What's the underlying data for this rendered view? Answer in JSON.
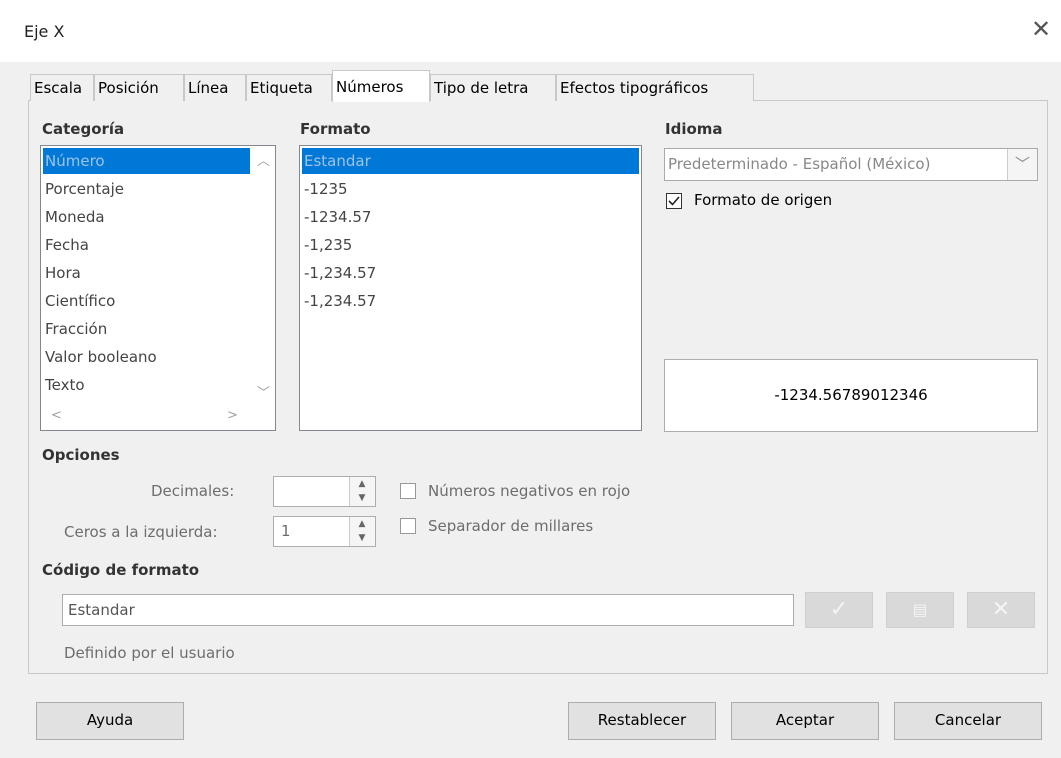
{
  "window": {
    "title": "Eje X",
    "close_glyph": "✕"
  },
  "tabs": [
    {
      "label": "Escala"
    },
    {
      "label": "Posición"
    },
    {
      "label": "Línea"
    },
    {
      "label": "Etiqueta"
    },
    {
      "label": "Números"
    },
    {
      "label": "Tipo de letra"
    },
    {
      "label": "Efectos tipográficos"
    }
  ],
  "categoria": {
    "header": "Categoría",
    "items": [
      "Número",
      "Porcentaje",
      "Moneda",
      "Fecha",
      "Hora",
      "Científico",
      "Fracción",
      "Valor booleano",
      "Texto"
    ],
    "selected_index": 0
  },
  "formato": {
    "header": "Formato",
    "items": [
      "Estandar",
      "-1235",
      "-1234.57",
      "-1,235",
      "-1,234.57",
      "-1,234.57"
    ],
    "selected_index": 0
  },
  "idioma": {
    "header": "Idioma",
    "value": "Predeterminado - Español (México)",
    "source_format_label": "Formato de origen",
    "source_format_checked": true
  },
  "preview": {
    "value": "-1234.56789012346"
  },
  "opciones": {
    "header": "Opciones",
    "decimales_label": "Decimales:",
    "decimales_value": "",
    "ceros_label": "Ceros a la izquierda:",
    "ceros_value": "1",
    "negativos_label": "Números negativos en rojo",
    "negativos_checked": false,
    "separador_label": "Separador de millares",
    "separador_checked": false
  },
  "codigo": {
    "header": "Código de formato",
    "value": "Estandar",
    "note": "Definido por el usuario"
  },
  "buttons": {
    "help": "Ayuda",
    "reset": "Restablecer",
    "ok": "Aceptar",
    "cancel": "Cancelar"
  },
  "icons": {
    "accept_format": "checkmark-icon",
    "edit_comment": "comment-icon",
    "delete_format": "delete-icon"
  },
  "colors": {
    "selection": "#0078d7",
    "window_bg": "#f0f0f0"
  }
}
